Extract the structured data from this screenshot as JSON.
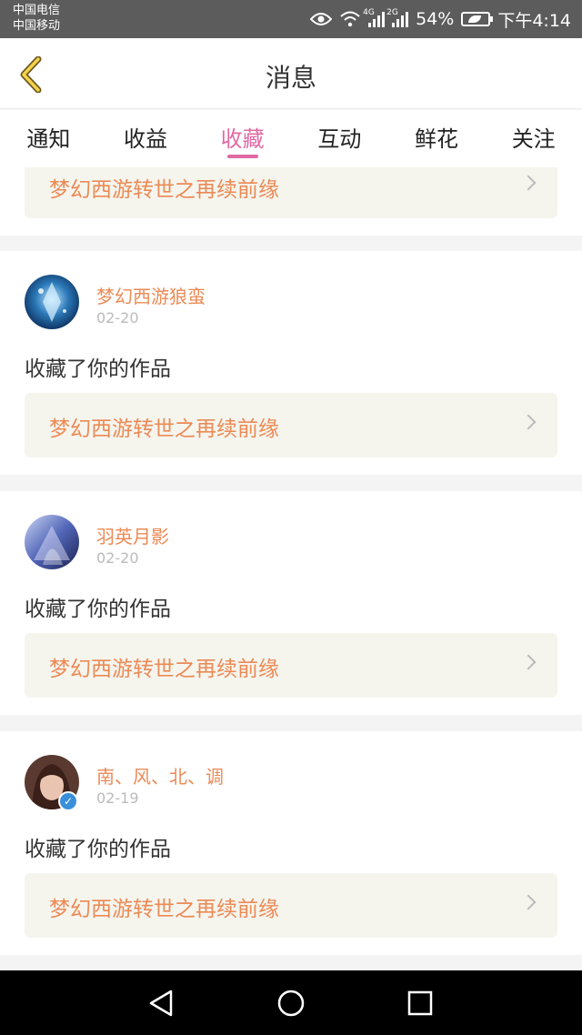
{
  "status_bar": {
    "carrier1": "中国电信",
    "carrier2": "中国移动",
    "net1": "4G",
    "net2": "2G",
    "battery": "54%",
    "time": "下午4:14"
  },
  "header": {
    "title": "消息"
  },
  "tabs": [
    {
      "label": "通知",
      "active": false
    },
    {
      "label": "收益",
      "active": false
    },
    {
      "label": "收藏",
      "active": true
    },
    {
      "label": "互动",
      "active": false
    },
    {
      "label": "鲜花",
      "active": false
    },
    {
      "label": "关注",
      "active": false
    }
  ],
  "partial_card": {
    "work_title": "梦幻西游转世之再续前缘"
  },
  "messages": [
    {
      "username": "梦幻西游狼蛮",
      "date": "02-20",
      "action": "收藏了你的作品",
      "work_title": "梦幻西游转世之再续前缘",
      "verified": false
    },
    {
      "username": "羽英月影",
      "date": "02-20",
      "action": "收藏了你的作品",
      "work_title": "梦幻西游转世之再续前缘",
      "verified": false
    },
    {
      "username": "南、风、北、调",
      "date": "02-19",
      "action": "收藏了你的作品",
      "work_title": "梦幻西游转世之再续前缘",
      "verified": true
    }
  ],
  "colors": {
    "accent": "#e06aa3",
    "name": "#ec8a55",
    "verified": "#3a8fd9"
  }
}
